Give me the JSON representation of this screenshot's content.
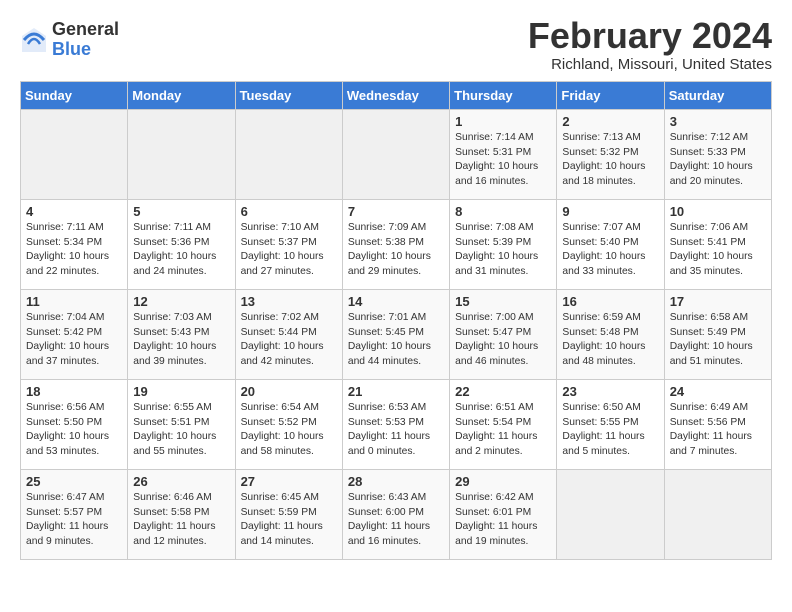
{
  "logo": {
    "general": "General",
    "blue": "Blue"
  },
  "title": "February 2024",
  "location": "Richland, Missouri, United States",
  "days_header": [
    "Sunday",
    "Monday",
    "Tuesday",
    "Wednesday",
    "Thursday",
    "Friday",
    "Saturday"
  ],
  "weeks": [
    [
      {
        "day": "",
        "content": ""
      },
      {
        "day": "",
        "content": ""
      },
      {
        "day": "",
        "content": ""
      },
      {
        "day": "",
        "content": ""
      },
      {
        "day": "1",
        "content": "Sunrise: 7:14 AM\nSunset: 5:31 PM\nDaylight: 10 hours\nand 16 minutes."
      },
      {
        "day": "2",
        "content": "Sunrise: 7:13 AM\nSunset: 5:32 PM\nDaylight: 10 hours\nand 18 minutes."
      },
      {
        "day": "3",
        "content": "Sunrise: 7:12 AM\nSunset: 5:33 PM\nDaylight: 10 hours\nand 20 minutes."
      }
    ],
    [
      {
        "day": "4",
        "content": "Sunrise: 7:11 AM\nSunset: 5:34 PM\nDaylight: 10 hours\nand 22 minutes."
      },
      {
        "day": "5",
        "content": "Sunrise: 7:11 AM\nSunset: 5:36 PM\nDaylight: 10 hours\nand 24 minutes."
      },
      {
        "day": "6",
        "content": "Sunrise: 7:10 AM\nSunset: 5:37 PM\nDaylight: 10 hours\nand 27 minutes."
      },
      {
        "day": "7",
        "content": "Sunrise: 7:09 AM\nSunset: 5:38 PM\nDaylight: 10 hours\nand 29 minutes."
      },
      {
        "day": "8",
        "content": "Sunrise: 7:08 AM\nSunset: 5:39 PM\nDaylight: 10 hours\nand 31 minutes."
      },
      {
        "day": "9",
        "content": "Sunrise: 7:07 AM\nSunset: 5:40 PM\nDaylight: 10 hours\nand 33 minutes."
      },
      {
        "day": "10",
        "content": "Sunrise: 7:06 AM\nSunset: 5:41 PM\nDaylight: 10 hours\nand 35 minutes."
      }
    ],
    [
      {
        "day": "11",
        "content": "Sunrise: 7:04 AM\nSunset: 5:42 PM\nDaylight: 10 hours\nand 37 minutes."
      },
      {
        "day": "12",
        "content": "Sunrise: 7:03 AM\nSunset: 5:43 PM\nDaylight: 10 hours\nand 39 minutes."
      },
      {
        "day": "13",
        "content": "Sunrise: 7:02 AM\nSunset: 5:44 PM\nDaylight: 10 hours\nand 42 minutes."
      },
      {
        "day": "14",
        "content": "Sunrise: 7:01 AM\nSunset: 5:45 PM\nDaylight: 10 hours\nand 44 minutes."
      },
      {
        "day": "15",
        "content": "Sunrise: 7:00 AM\nSunset: 5:47 PM\nDaylight: 10 hours\nand 46 minutes."
      },
      {
        "day": "16",
        "content": "Sunrise: 6:59 AM\nSunset: 5:48 PM\nDaylight: 10 hours\nand 48 minutes."
      },
      {
        "day": "17",
        "content": "Sunrise: 6:58 AM\nSunset: 5:49 PM\nDaylight: 10 hours\nand 51 minutes."
      }
    ],
    [
      {
        "day": "18",
        "content": "Sunrise: 6:56 AM\nSunset: 5:50 PM\nDaylight: 10 hours\nand 53 minutes."
      },
      {
        "day": "19",
        "content": "Sunrise: 6:55 AM\nSunset: 5:51 PM\nDaylight: 10 hours\nand 55 minutes."
      },
      {
        "day": "20",
        "content": "Sunrise: 6:54 AM\nSunset: 5:52 PM\nDaylight: 10 hours\nand 58 minutes."
      },
      {
        "day": "21",
        "content": "Sunrise: 6:53 AM\nSunset: 5:53 PM\nDaylight: 11 hours\nand 0 minutes."
      },
      {
        "day": "22",
        "content": "Sunrise: 6:51 AM\nSunset: 5:54 PM\nDaylight: 11 hours\nand 2 minutes."
      },
      {
        "day": "23",
        "content": "Sunrise: 6:50 AM\nSunset: 5:55 PM\nDaylight: 11 hours\nand 5 minutes."
      },
      {
        "day": "24",
        "content": "Sunrise: 6:49 AM\nSunset: 5:56 PM\nDaylight: 11 hours\nand 7 minutes."
      }
    ],
    [
      {
        "day": "25",
        "content": "Sunrise: 6:47 AM\nSunset: 5:57 PM\nDaylight: 11 hours\nand 9 minutes."
      },
      {
        "day": "26",
        "content": "Sunrise: 6:46 AM\nSunset: 5:58 PM\nDaylight: 11 hours\nand 12 minutes."
      },
      {
        "day": "27",
        "content": "Sunrise: 6:45 AM\nSunset: 5:59 PM\nDaylight: 11 hours\nand 14 minutes."
      },
      {
        "day": "28",
        "content": "Sunrise: 6:43 AM\nSunset: 6:00 PM\nDaylight: 11 hours\nand 16 minutes."
      },
      {
        "day": "29",
        "content": "Sunrise: 6:42 AM\nSunset: 6:01 PM\nDaylight: 11 hours\nand 19 minutes."
      },
      {
        "day": "",
        "content": ""
      },
      {
        "day": "",
        "content": ""
      }
    ]
  ]
}
